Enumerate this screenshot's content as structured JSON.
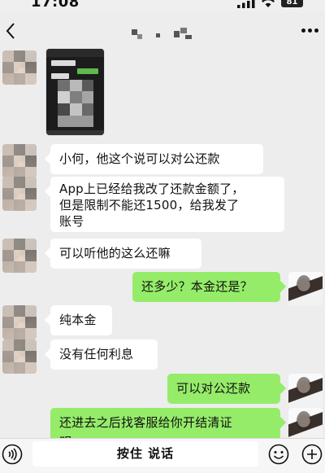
{
  "status_bar": {
    "time": "17:08",
    "battery": "81"
  },
  "nav": {
    "title": ""
  },
  "messages": [
    {
      "side": "in",
      "type": "image"
    },
    {
      "side": "in",
      "type": "text",
      "text": "小何，他这个说可以对公还款"
    },
    {
      "side": "in",
      "type": "text",
      "text": "App上已经给我改了还款金额了，\n但是限制不能还1500，给我发了\n账号"
    },
    {
      "side": "in",
      "type": "text",
      "text": "可以听他的这么还嘛"
    },
    {
      "side": "out",
      "type": "text",
      "text": "还多少？本金还是？"
    },
    {
      "side": "in",
      "type": "text",
      "text": "纯本金"
    },
    {
      "side": "in",
      "type": "text",
      "text": "没有任何利息"
    },
    {
      "side": "out",
      "type": "text",
      "text": "可以对公还款"
    },
    {
      "side": "out",
      "type": "text",
      "text": "还进去之后找客服给你开结清证\n明"
    }
  ],
  "input_bar": {
    "hold_to_talk": "按住 说话"
  },
  "icons": {
    "back": "back-icon",
    "more": "more-icon",
    "voice": "voice-icon",
    "emoji": "emoji-icon",
    "plus": "plus-icon"
  },
  "colors": {
    "incoming_bubble": "#ffffff",
    "outgoing_bubble": "#95ec69",
    "background": "#ededed"
  }
}
